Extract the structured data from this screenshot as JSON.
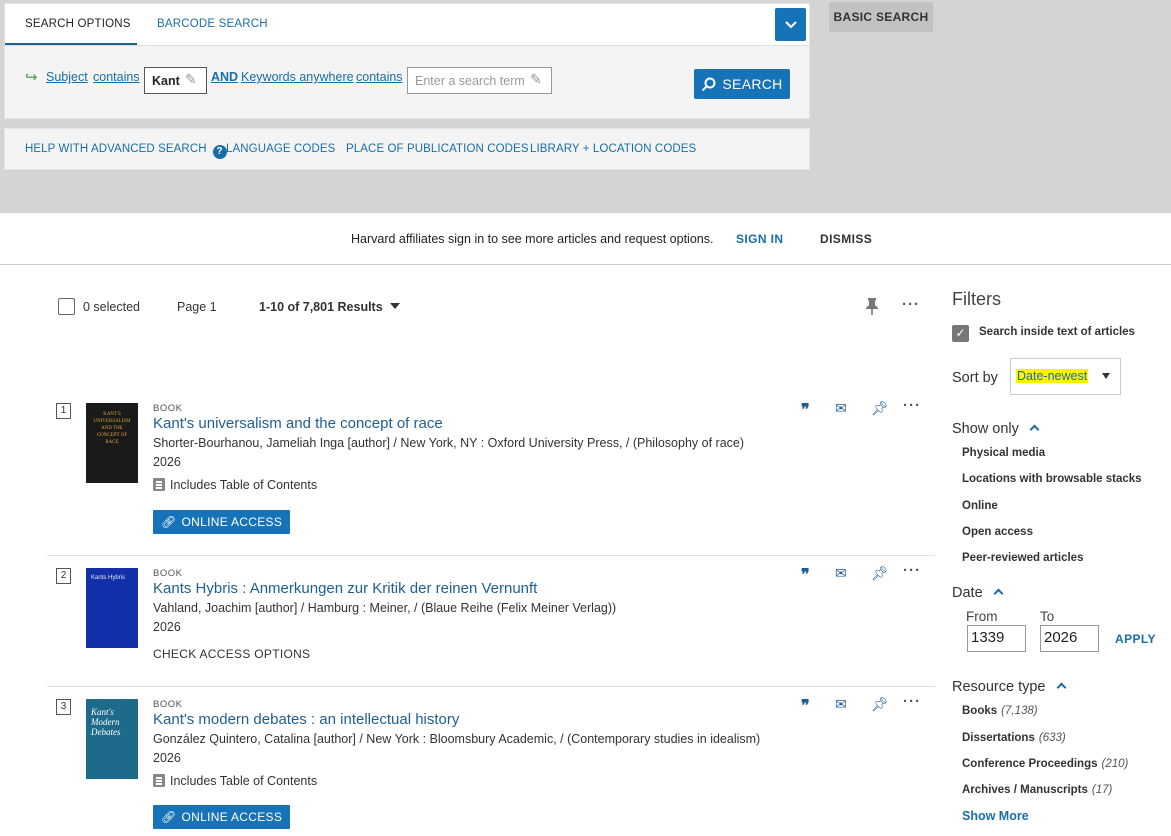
{
  "search": {
    "tab_active": "SEARCH OPTIONS",
    "tab_barcode": "BARCODE SEARCH",
    "field1": "Subject",
    "op1": "contains",
    "term1": "Kant",
    "bool": "AND",
    "field2": "Keywords anywhere",
    "op2": "contains",
    "placeholder2": "Enter a search term",
    "search_button": "SEARCH",
    "basic_search": "BASIC SEARCH"
  },
  "helplinks": {
    "help": "HELP WITH ADVANCED SEARCH",
    "language": "LANGUAGE CODES",
    "place": "PLACE OF PUBLICATION CODES",
    "library": "LIBRARY + LOCATION CODES"
  },
  "signin": {
    "message": "Harvard affiliates sign in to see more articles and request options.",
    "signin": "SIGN IN",
    "dismiss": "DISMISS"
  },
  "results_header": {
    "selected": "0 selected",
    "page": "Page 1",
    "range": "1-10 of 7,801 Results"
  },
  "results": [
    {
      "num": "1",
      "type": "BOOK",
      "title": "Kant's universalism and the concept of race",
      "author": "Shorter-Bourhanou, Jameliah Inga [author] / New York, NY : Oxford University Press, / (Philosophy of race)",
      "year": "2026",
      "toc": "Includes Table of Contents",
      "access": "ONLINE ACCESS",
      "cover_text": "KANT'S UNIVERSALISM AND THE CONCEPT OF RACE"
    },
    {
      "num": "2",
      "type": "BOOK",
      "title": "Kants Hybris : Anmerkungen zur Kritik der reinen Vernunft",
      "author": "Vahland, Joachim [author] / Hamburg : Meiner, / (Blaue Reihe (Felix Meiner Verlag))",
      "year": "2026",
      "access": "CHECK ACCESS OPTIONS",
      "cover_text": "Kants Hybris"
    },
    {
      "num": "3",
      "type": "BOOK",
      "title": "Kant's modern debates : an intellectual history",
      "author": "González Quintero, Catalina [author] / New York : Bloomsbury Academic, / (Contemporary studies in idealism)",
      "year": "2026",
      "toc": "Includes Table of Contents",
      "access": "ONLINE ACCESS",
      "cover_text": "Kant's Modern Debates"
    }
  ],
  "filters": {
    "title": "Filters",
    "search_inside": "Search inside text of articles",
    "sort_label": "Sort by",
    "sort_value": "Date-newest",
    "show_only": {
      "label": "Show only",
      "items": [
        "Physical media",
        "Locations with browsable stacks",
        "Online",
        "Open access",
        "Peer-reviewed articles"
      ]
    },
    "date": {
      "label": "Date",
      "from_label": "From",
      "to_label": "To",
      "from": "1339",
      "to": "2026",
      "apply": "APPLY"
    },
    "resource_type": {
      "label": "Resource type",
      "items": [
        {
          "name": "Books",
          "count": "(7,138)"
        },
        {
          "name": "Dissertations",
          "count": "(633)"
        },
        {
          "name": "Conference Proceedings",
          "count": "(210)"
        },
        {
          "name": "Archives / Manuscripts",
          "count": "(17)"
        }
      ],
      "show_more": "Show More"
    }
  }
}
